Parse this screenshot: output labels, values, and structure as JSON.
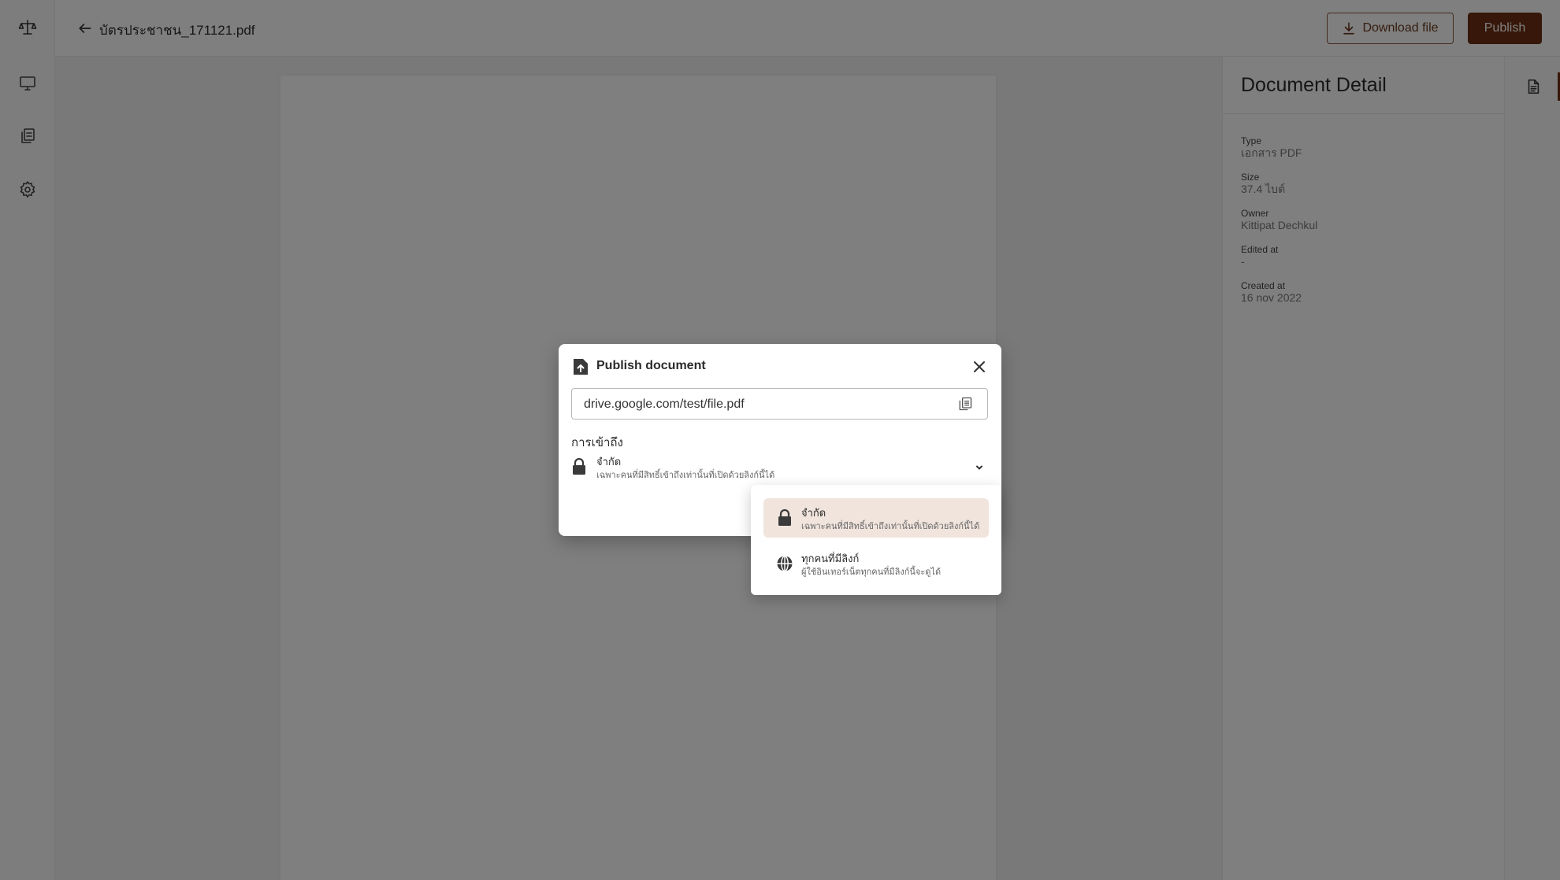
{
  "header": {
    "file_name": "บัตรประชาชน_171121.pdf",
    "download_label": "Download file",
    "publish_label": "Publish"
  },
  "left_rail": {
    "icons": [
      "scale-logo-icon",
      "monitor-icon",
      "documents-icon",
      "settings-icon"
    ]
  },
  "detail": {
    "title": "Document Detail",
    "fields": [
      {
        "label": "Type",
        "value": "เอกสาร PDF"
      },
      {
        "label": "Size",
        "value": "37.4 ไบต์"
      },
      {
        "label": "Owner",
        "value": "Kittipat Dechkul"
      },
      {
        "label": "Edited at",
        "value": "-"
      },
      {
        "label": "Created at",
        "value": "16 nov 2022"
      }
    ]
  },
  "modal": {
    "title": "Publish document",
    "link": "drive.google.com/test/file.pdf",
    "access_heading": "การเข้าถึง",
    "selected": {
      "name": "จำกัด",
      "desc": "เฉพาะคนที่มีสิทธิ์เข้าถึงเท่านั้นที่เปิดด้วยลิงก์นี้ได้"
    }
  },
  "dropdown": {
    "options": [
      {
        "name": "จำกัด",
        "desc": "เฉพาะคนที่มีสิทธิ์เข้าถึงเท่านั้นที่เปิดด้วยลิงก์นี้ได้",
        "icon": "lock-icon",
        "selected": true
      },
      {
        "name": "ทุกคนที่มีลิงก์",
        "desc": "ผู้ใช้อินเทอร์เน็ตทุกคนที่มีลิงก์นี้จะดูได้",
        "icon": "globe-icon",
        "selected": false
      }
    ]
  },
  "colors": {
    "brand": "#6d2f12",
    "selected_option_bg": "#f0e4dd",
    "scrim": "rgba(0,0,0,0.5)"
  }
}
